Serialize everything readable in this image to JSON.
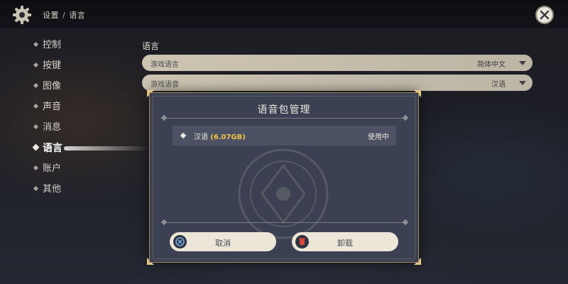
{
  "breadcrumb": {
    "parent": "设置",
    "separator": "/",
    "current": "语言"
  },
  "nav": [
    {
      "label": "控制",
      "active": false
    },
    {
      "label": "按键",
      "active": false
    },
    {
      "label": "图像",
      "active": false
    },
    {
      "label": "声音",
      "active": false
    },
    {
      "label": "消息",
      "active": false
    },
    {
      "label": "语言",
      "active": true
    },
    {
      "label": "账户",
      "active": false
    },
    {
      "label": "其他",
      "active": false
    }
  ],
  "language_section": {
    "title": "语言",
    "game_language": {
      "label": "游戏语言",
      "value": "简体中文"
    },
    "game_voice": {
      "label": "游戏语音",
      "value": "汉语"
    }
  },
  "dialog": {
    "title": "语音包管理",
    "pack": {
      "name": "汉语",
      "size": "(6.07GB)",
      "status": "使用中"
    },
    "cancel_label": "取消",
    "uninstall_label": "卸载"
  },
  "icons": {
    "settings": "gear-icon",
    "close": "close-icon",
    "cancel": "x-icon",
    "uninstall": "trash-icon"
  },
  "colors": {
    "accent_gold": "#f0c14b",
    "dialog_bg": "#3b4152",
    "row_bg": "#cdc4b2",
    "button_bg": "#ece6d8"
  }
}
